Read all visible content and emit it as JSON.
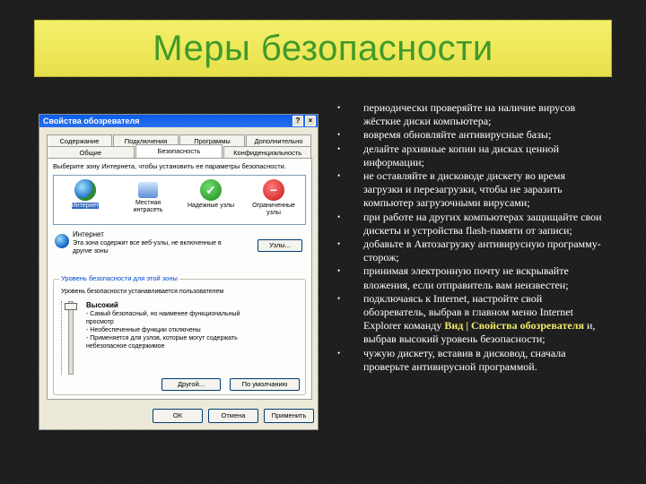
{
  "slide": {
    "title": "Меры безопасности"
  },
  "dialog": {
    "title": "Свойства обозревателя",
    "title_buttons": [
      "?",
      "×"
    ],
    "tabs_row1": [
      "Содержание",
      "Подключения",
      "Программы",
      "Дополнительно"
    ],
    "tabs_row2": [
      "Общие",
      "Безопасность",
      "Конфиденциальность"
    ],
    "zones_label": "Выберите зону Интернета, чтобы установить ее параметры безопасности.",
    "zones": [
      {
        "icon": "globe-icon",
        "label": "Интернет",
        "selected": true
      },
      {
        "icon": "computer-icon",
        "label": "Местная интрасеть",
        "selected": false
      },
      {
        "icon": "check-icon",
        "label": "Надежные узлы",
        "selected": false
      },
      {
        "icon": "stop-icon",
        "label": "Ограниченные узлы",
        "selected": false
      }
    ],
    "zone_info": {
      "title": "Интернет",
      "text": "Эта зона содержит все веб-узлы, не включенные в другие зоны",
      "sites_button": "Узлы..."
    },
    "security_level": {
      "group_title": "Уровень безопасности для этой зоны",
      "subtitle": "Уровень безопасности устанавливается пользователем",
      "level_name": "Высокий",
      "description": [
        "- Самый безопасный, но наименее функциональный",
        "  просмотр",
        "- Необеспеченные функции отключены",
        "- Применяется для узлов, которые могут содержать",
        "  небезопасное содержимое"
      ],
      "other_button": "Другой...",
      "default_button": "По умолчанию"
    },
    "footer_buttons": [
      "ОК",
      "Отмена",
      "Применить"
    ]
  },
  "bullets": [
    {
      "text": "периодически проверяйте на     наличие вирусов жёсткие диски компьютера;"
    },
    {
      "text": "вовремя обновляйте антивирусные базы;"
    },
    {
      "text": "делайте архивные копии на дисках ценной информации;"
    },
    {
      "text": "не оставляйте в дисководе дискету во время   загрузки и перезагрузки, чтобы не заразить компьютер загрузочными вирусами;"
    },
    {
      "text": "при работе на других компьютерах защищайте свои дискеты и устройства flash-памяти от записи;"
    },
    {
      "text": "добавьте в Автозагрузку антивирусную программу-сторож;"
    },
    {
      "text": "принимая электронную почту не вскрывайте вложения, если отправитель вам неизвестен;"
    },
    {
      "text_before": "подключаясь к  Internet, настройте свой обозреватель, выбрав в  главном меню Internet Explorer команду ",
      "highlight": "Вид | Свойства обозревателя",
      "text_after": " и, выбрав высокий уровень безопасности;"
    },
    {
      "text": "чужую дискету, вставив в дисковод, сначала проверьте антивирусной программой."
    }
  ],
  "colors": {
    "title_bg": "#f0ea5c",
    "title_text": "#3f9a2a",
    "highlight": "#f2ea6a"
  }
}
